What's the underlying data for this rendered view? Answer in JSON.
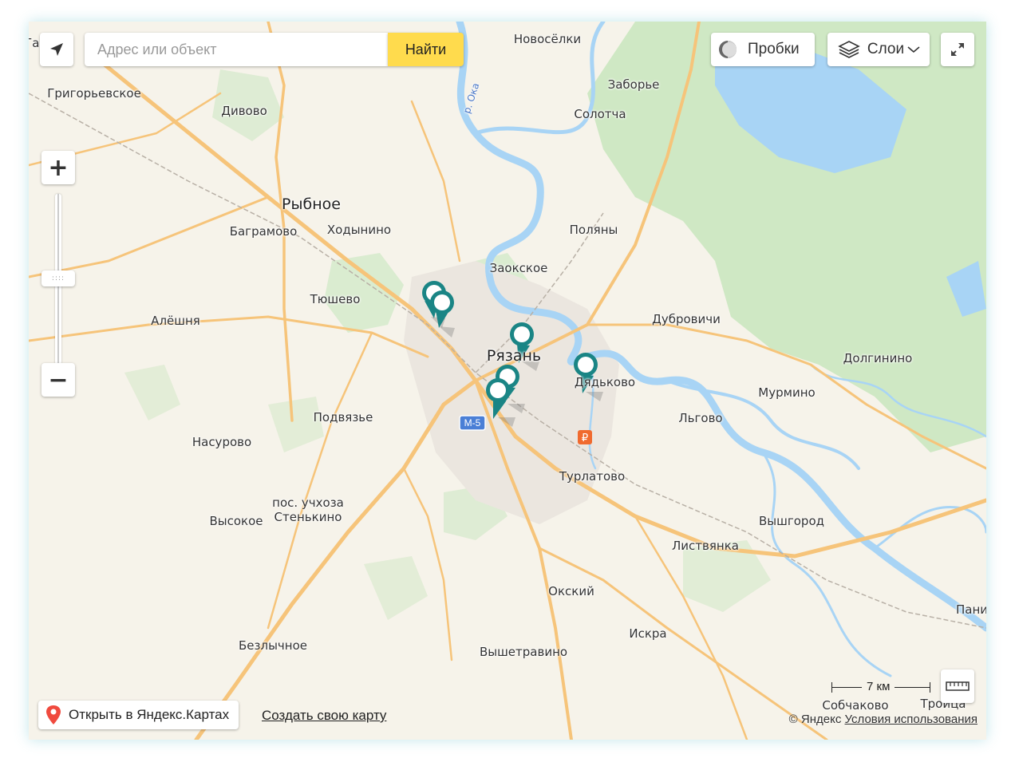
{
  "search": {
    "placeholder": "Адрес или объект",
    "button_label": "Найти"
  },
  "controls": {
    "traffic_label": "Пробки",
    "layers_label": "Слои",
    "zoom_in": "+",
    "zoom_out": "−",
    "zoom_handle": "::::"
  },
  "footer": {
    "open_in_yandex": "Открыть в Яндекс.Картах",
    "create_map": "Создать свою карту",
    "copyright_prefix": "© Яндекс",
    "terms": "Условия использования",
    "scale_label": "7 км"
  },
  "map": {
    "road_badge": "М-5",
    "places": [
      {
        "name": "Га..ов",
        "cls": ""
      },
      {
        "name": "Новосёлки",
        "cls": ""
      },
      {
        "name": "Заборье",
        "cls": ""
      },
      {
        "name": "Солотча",
        "cls": ""
      },
      {
        "name": "Григорьевское",
        "cls": ""
      },
      {
        "name": "Дивово",
        "cls": ""
      },
      {
        "name": "р. Ока",
        "cls": "river"
      },
      {
        "name": "Рыбное",
        "cls": "big"
      },
      {
        "name": "Баграмово",
        "cls": ""
      },
      {
        "name": "Ходынино",
        "cls": ""
      },
      {
        "name": "Поляны",
        "cls": ""
      },
      {
        "name": "Заокское",
        "cls": ""
      },
      {
        "name": "Тюшево",
        "cls": ""
      },
      {
        "name": "Алёшня",
        "cls": ""
      },
      {
        "name": "Дубровичи",
        "cls": ""
      },
      {
        "name": "Рязань",
        "cls": "big"
      },
      {
        "name": "Долгинино",
        "cls": ""
      },
      {
        "name": "Дядьково",
        "cls": ""
      },
      {
        "name": "Мурмино",
        "cls": ""
      },
      {
        "name": "Подвязье",
        "cls": ""
      },
      {
        "name": "Льгово",
        "cls": ""
      },
      {
        "name": "Насурово",
        "cls": ""
      },
      {
        "name": "Турлатово",
        "cls": ""
      },
      {
        "name": "пос. учхоза",
        "cls": ""
      },
      {
        "name": "Стенькино",
        "cls": ""
      },
      {
        "name": "Высокое",
        "cls": ""
      },
      {
        "name": "Вышгород",
        "cls": ""
      },
      {
        "name": "Листвянка",
        "cls": ""
      },
      {
        "name": "Окский",
        "cls": ""
      },
      {
        "name": "Пани",
        "cls": ""
      },
      {
        "name": "Искра",
        "cls": ""
      },
      {
        "name": "Безлычное",
        "cls": ""
      },
      {
        "name": "Вышетравино",
        "cls": ""
      },
      {
        "name": "Собчаково",
        "cls": ""
      },
      {
        "name": "Троица",
        "cls": ""
      }
    ]
  },
  "colors": {
    "accent_yellow": "#ffdb4d",
    "marker_teal": "#1a8585",
    "river_blue": "#a8d4f5",
    "forest_green": "#cfe8c4",
    "road_orange": "#f6c47a",
    "urban_gray": "#ebe6df",
    "pin_red": "#f04a3e"
  }
}
